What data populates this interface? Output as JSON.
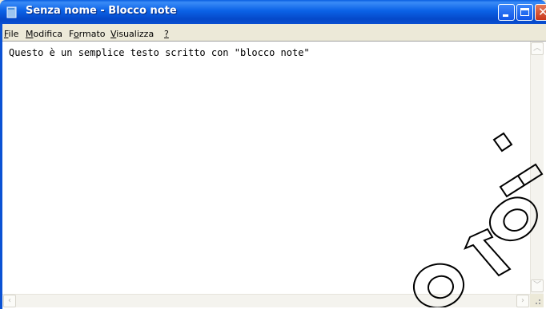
{
  "window": {
    "title": "Senza nome - Blocco note",
    "icon": "notepad-icon"
  },
  "menu": [
    {
      "mnemonic": "F",
      "rest": "ile"
    },
    {
      "mnemonic": "M",
      "rest": "odifica"
    },
    {
      "pre": "F",
      "mnemonic": "o",
      "rest": "rmato"
    },
    {
      "mnemonic": "V",
      "rest": "isualizza"
    },
    {
      "mnemonic": "?",
      "rest": ""
    }
  ],
  "editor": {
    "content": "Questo è un semplice testo scritto con \"blocco note\""
  },
  "colors": {
    "titlebar": "#0b62e6",
    "frame": "#0b52d4",
    "close_button": "#c8361a"
  }
}
